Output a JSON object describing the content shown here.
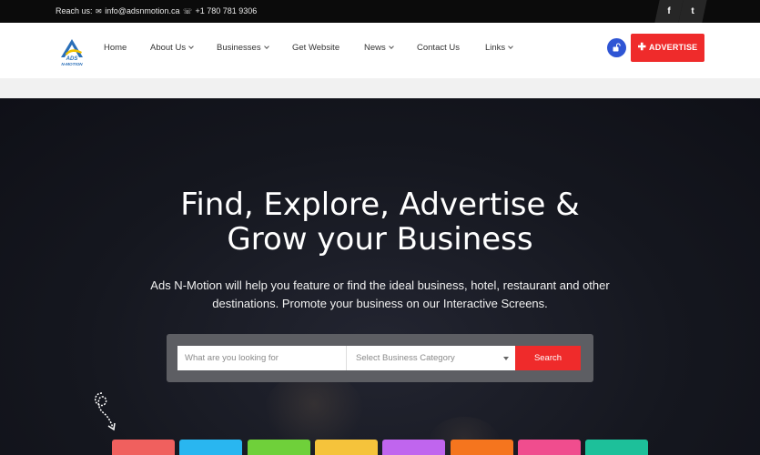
{
  "topbar": {
    "reach_label": "Reach us:",
    "email_icon": "envelope-icon",
    "email": "info@adsnmotion.ca",
    "phone_icon": "phone-icon",
    "phone": "+1 780 781 9306",
    "social": [
      {
        "name": "facebook-icon",
        "glyph": "f"
      },
      {
        "name": "twitter-icon",
        "glyph": "t"
      }
    ]
  },
  "brand": {
    "logo_text_top": "ADS",
    "logo_text_bottom": "N-MOTION",
    "colors": {
      "blue": "#2a6fb8",
      "yellow": "#f2c200"
    }
  },
  "nav": {
    "items": [
      {
        "label": "Home",
        "dropdown": false
      },
      {
        "label": "About Us",
        "dropdown": true
      },
      {
        "label": "Businesses",
        "dropdown": true
      },
      {
        "label": "Get Website",
        "dropdown": false
      },
      {
        "label": "News",
        "dropdown": true
      },
      {
        "label": "Contact Us",
        "dropdown": false
      },
      {
        "label": "Links",
        "dropdown": true
      }
    ],
    "lock_icon": "unlock-icon",
    "advertise_label": "ADVERTISE",
    "advertise_icon": "plus-icon"
  },
  "hero": {
    "headline_line1": "Find, Explore, Advertise &",
    "headline_line2": "Grow your Business",
    "subtext": "Ads N-Motion will help you feature or find the ideal business, hotel, restaurant and other destinations. Promote your business on our Interactive Screens.",
    "search": {
      "placeholder": "What are you looking for",
      "category_placeholder": "Select Business Category",
      "button_label": "Search"
    },
    "decor_icon": "curly-arrow-icon"
  },
  "category_tiles": [
    {
      "color": "#f0605e"
    },
    {
      "color": "#29b6f0"
    },
    {
      "color": "#6fd03a"
    },
    {
      "color": "#f5c33b"
    },
    {
      "color": "#c065ee"
    },
    {
      "color": "#f5751e"
    },
    {
      "color": "#f04d8e"
    },
    {
      "color": "#1dc09a"
    }
  ],
  "colors": {
    "accent_red": "#ef2b2b",
    "lock_blue": "#2f55d4",
    "topbar_bg": "#0b0b0b"
  }
}
